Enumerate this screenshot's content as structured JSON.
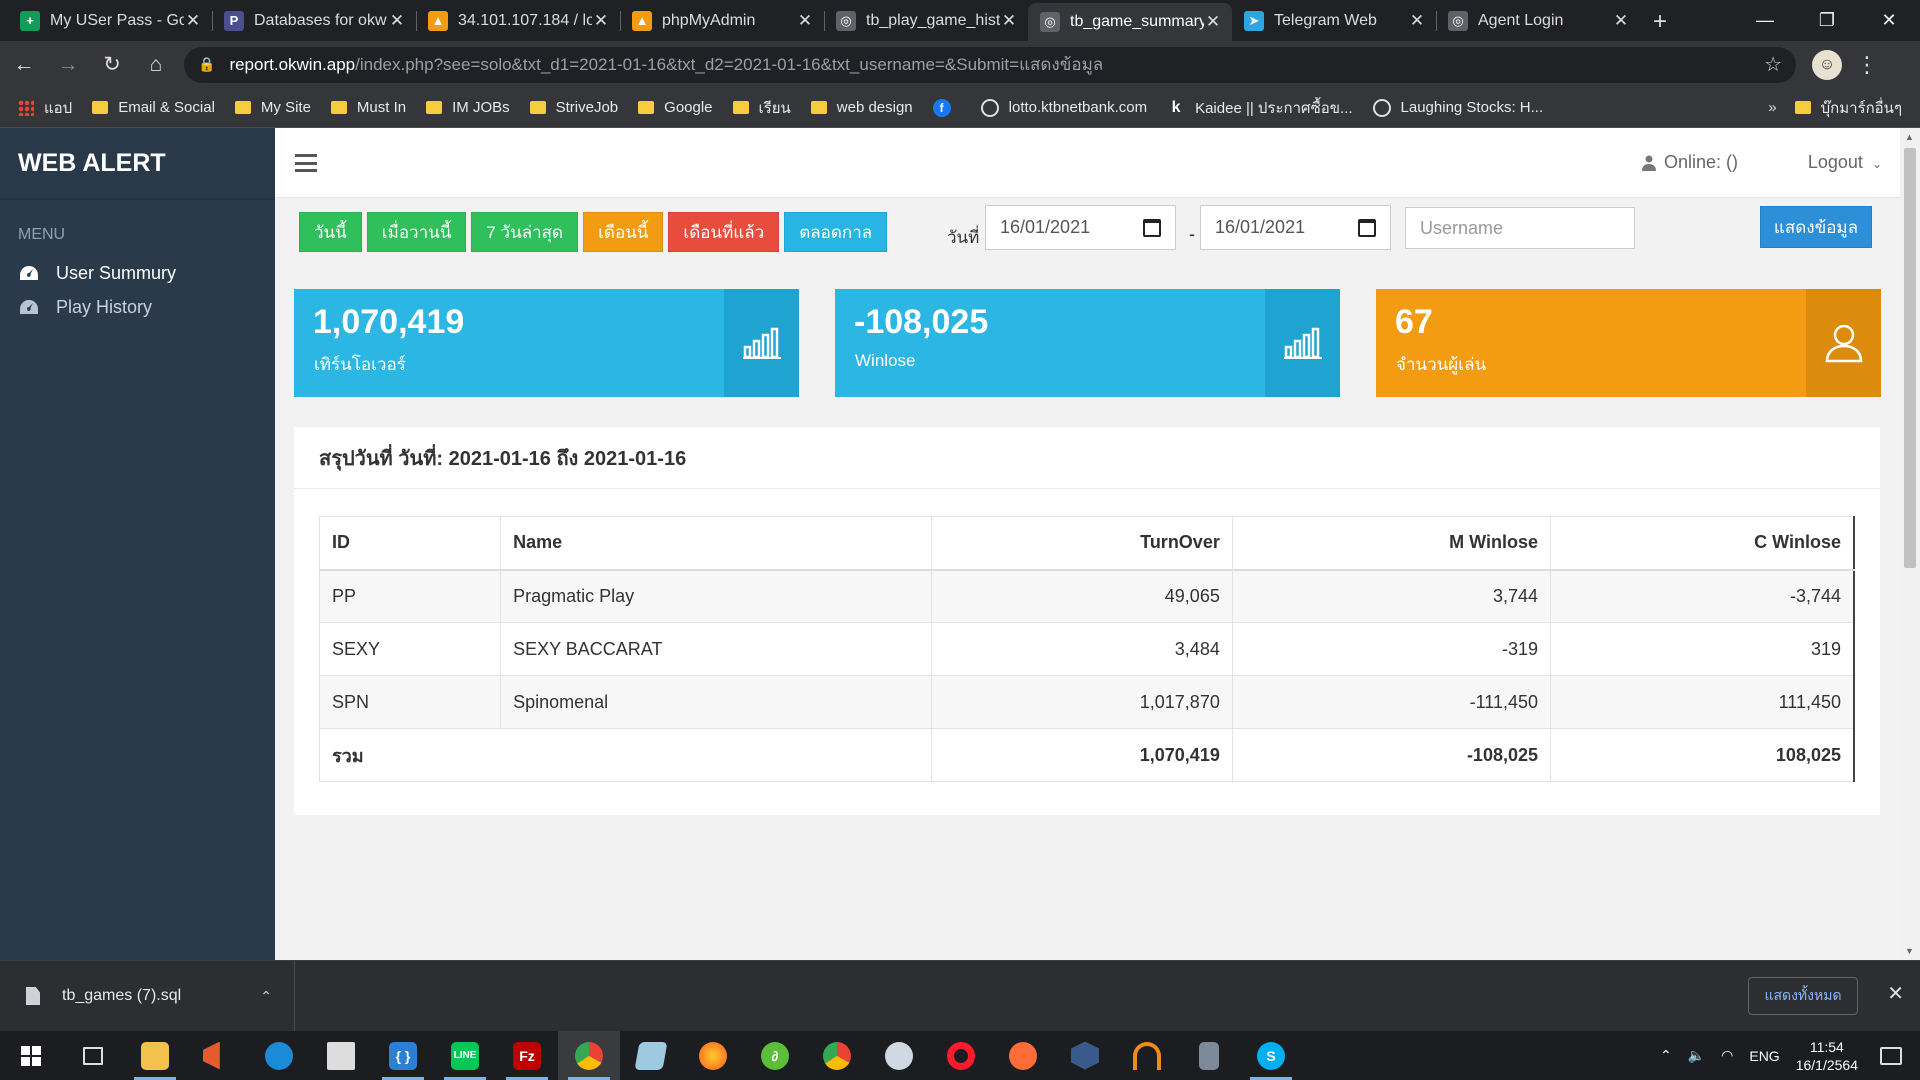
{
  "browser": {
    "tabs": [
      {
        "title": "My USer Pass - Go",
        "icon_color": "#0f9d58",
        "icon_text": "+"
      },
      {
        "title": "Databases for okw",
        "icon_color": "#4a4f8f",
        "icon_text": "P"
      },
      {
        "title": "34.101.107.184 / lo",
        "icon_color": "#f39c12",
        "icon_text": "▲"
      },
      {
        "title": "phpMyAdmin",
        "icon_color": "#f39c12",
        "icon_text": "▲"
      },
      {
        "title": "tb_play_game_hist",
        "icon_color": "#5f6368",
        "icon_text": "◎"
      },
      {
        "title": "tb_game_summary",
        "icon_color": "#5f6368",
        "icon_text": "◎",
        "active": true
      },
      {
        "title": "Telegram Web",
        "icon_color": "#2ca5e0",
        "icon_text": "➤"
      },
      {
        "title": "Agent Login",
        "icon_color": "#5f6368",
        "icon_text": "◎"
      }
    ],
    "url_host": "report.okwin.app",
    "url_path": "/index.php?see=solo&txt_d1=2021-01-16&txt_d2=2021-01-16&txt_username=&Submit=แสดงข้อมูล",
    "bookmarks": [
      {
        "label": "แอป",
        "type": "apps"
      },
      {
        "label": "Email & Social",
        "type": "folder"
      },
      {
        "label": "My Site",
        "type": "folder"
      },
      {
        "label": "Must In",
        "type": "folder"
      },
      {
        "label": "IM JOBs",
        "type": "folder"
      },
      {
        "label": "StriveJob",
        "type": "folder"
      },
      {
        "label": "Google",
        "type": "folder"
      },
      {
        "label": "เรียน",
        "type": "folder"
      },
      {
        "label": "web design",
        "type": "folder"
      },
      {
        "label": "",
        "type": "facebook"
      },
      {
        "label": "lotto.ktbnetbank.com",
        "type": "site"
      },
      {
        "label": "Kaidee || ประกาศซื้อข...",
        "type": "kaidee"
      },
      {
        "label": "Laughing Stocks: H...",
        "type": "site"
      }
    ],
    "bookmarks_more": "»",
    "bookmarks_other": "บุ๊กมาร์กอื่นๆ"
  },
  "sidebar": {
    "brand": "WEB ALERT",
    "menu_head": "MENU",
    "items": [
      {
        "label": "User Summury",
        "active": true
      },
      {
        "label": "Play History",
        "active": false
      }
    ]
  },
  "topbar": {
    "online": "Online: ()",
    "logout": "Logout"
  },
  "filters": {
    "buttons": [
      {
        "label": "วันนี้",
        "color": "g"
      },
      {
        "label": "เมื่อวานนี้",
        "color": "g"
      },
      {
        "label": "7 วันล่าสุด",
        "color": "g"
      },
      {
        "label": "เดือนนี้",
        "color": "o"
      },
      {
        "label": "เดือนที่แล้ว",
        "color": "r"
      },
      {
        "label": "ตลอดกาล",
        "color": "b"
      }
    ],
    "date_label": "วันที่",
    "date_from": "16/01/2021",
    "date_to": "16/01/2021",
    "username_placeholder": "Username",
    "submit": "แสดงข้อมูล"
  },
  "cards": [
    {
      "value": "1,070,419",
      "label": "เทิร์นโอเวอร์",
      "icon": "bar-chart-icon",
      "color": "cyan"
    },
    {
      "value": "-108,025",
      "label": "Winlose",
      "icon": "bar-chart-icon",
      "color": "cyan"
    },
    {
      "value": "67",
      "label": "จำนวนผู้เล่น",
      "icon": "user-icon",
      "color": "orange"
    }
  ],
  "summary": {
    "title": "สรุปวันที่ วันที่: 2021-01-16 ถึง 2021-01-16",
    "columns": [
      "ID",
      "Name",
      "TurnOver",
      "M Winlose",
      "C Winlose"
    ],
    "rows": [
      [
        "PP",
        "Pragmatic Play",
        "49,065",
        "3,744",
        "-3,744"
      ],
      [
        "SEXY",
        "SEXY BACCARAT",
        "3,484",
        "-319",
        "319"
      ],
      [
        "SPN",
        "Spinomenal",
        "1,017,870",
        "-111,450",
        "111,450"
      ]
    ],
    "total": [
      "รวม",
      "1,070,419",
      "-108,025",
      "108,025"
    ]
  },
  "downloads": {
    "file": "tb_games (7).sql",
    "show_all": "แสดงทั้งหมด"
  },
  "taskbar": {
    "language": "ENG",
    "time": "11:54",
    "date": "16/1/2564"
  }
}
